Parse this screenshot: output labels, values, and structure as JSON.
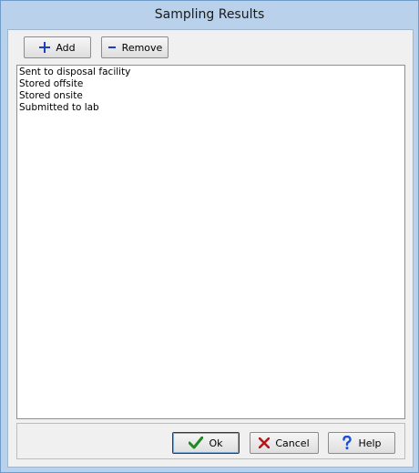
{
  "window": {
    "title": "Sampling Results"
  },
  "toolbar": {
    "add_label": "Add",
    "remove_label": "Remove"
  },
  "list": {
    "items": [
      "Sent to disposal facility",
      "Stored offsite",
      "Stored onsite",
      "Submitted to lab"
    ]
  },
  "footer": {
    "ok_label": "Ok",
    "cancel_label": "Cancel",
    "help_label": "Help"
  },
  "icons": {
    "add": "plus-icon",
    "remove": "minus-icon",
    "ok": "checkmark-icon",
    "cancel": "x-icon",
    "help": "question-mark-icon"
  },
  "colors": {
    "plus": "#1e3fbf",
    "minus": "#1e3fbf",
    "check": "#1f8a1f",
    "x": "#b3171b",
    "help": "#1c4fd6"
  }
}
